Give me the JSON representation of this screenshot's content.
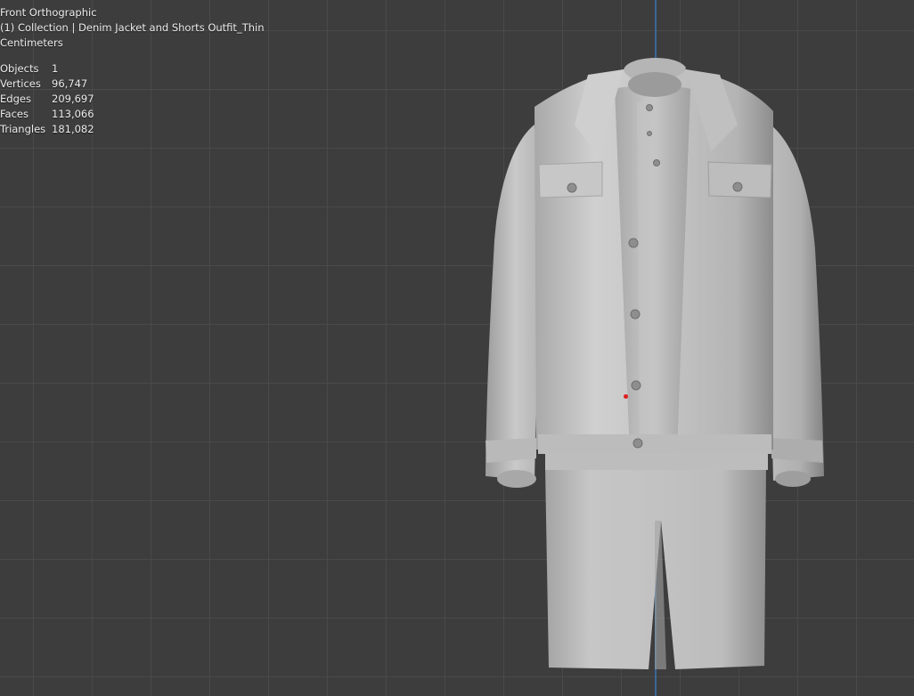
{
  "viewport": {
    "view_name": "Front Orthographic",
    "collection_line": "(1) Collection | Denim Jacket and Shorts Outfit_Thin",
    "units": "Centimeters"
  },
  "statistics": [
    {
      "label": "Objects",
      "value": "1"
    },
    {
      "label": "Vertices",
      "value": "96,747"
    },
    {
      "label": "Edges",
      "value": "209,697"
    },
    {
      "label": "Faces",
      "value": "113,066"
    },
    {
      "label": "Triangles",
      "value": "181,082"
    }
  ],
  "colors": {
    "background": "#3d3d3d",
    "grid_line": "#4a4a4a",
    "z_axis": "#3a6fa6",
    "origin": "#e01e1e",
    "mesh": "#c8c8c8"
  },
  "model": {
    "name": "Denim Jacket and Shorts Outfit_Thin",
    "shading": "solid"
  }
}
